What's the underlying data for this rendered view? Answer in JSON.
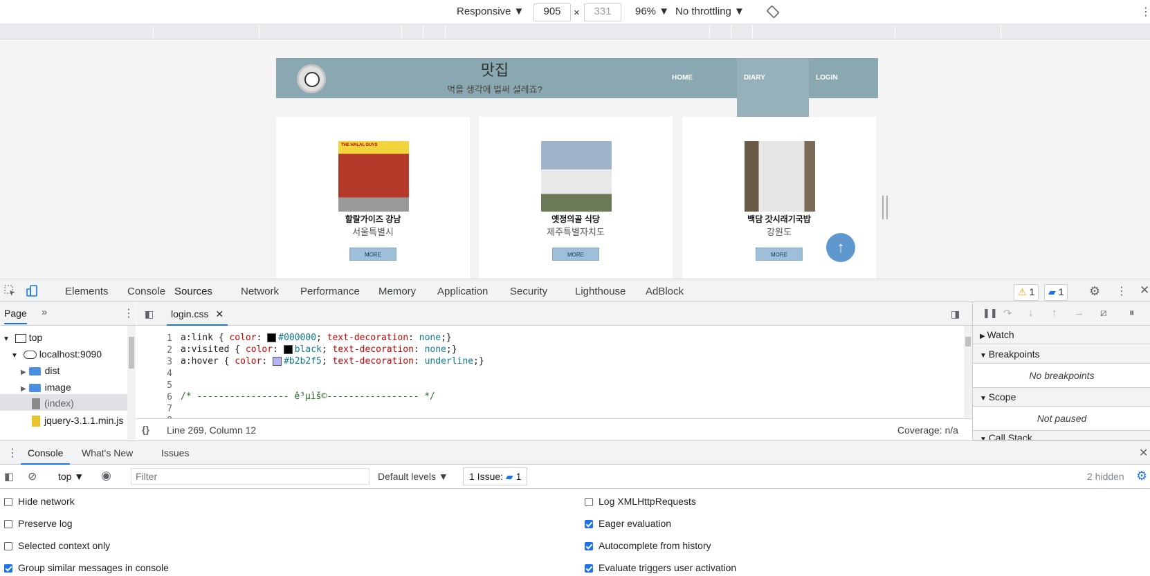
{
  "device_toolbar": {
    "mode": "Responsive ▼",
    "width": "905",
    "times": "×",
    "height": "331",
    "zoom": "96% ▼",
    "throttling": "No throttling ▼"
  },
  "site": {
    "title": "맛집",
    "subtitle": "먹을 생각에 벌써 설레죠?",
    "nav": [
      "HOME",
      "DIARY",
      "LOGIN"
    ],
    "cards": [
      {
        "name": "할랄가이즈 강남",
        "location": "서울특별시",
        "more": "MORE",
        "img_color": "#b53a2a",
        "sign": "THE HALAL GUYS"
      },
      {
        "name": "옛정의골 식당",
        "location": "제주특별자치도",
        "more": "MORE",
        "img_color": "#8fa3b8",
        "sign": ""
      },
      {
        "name": "백담 갓시래기국밥",
        "location": "강원도",
        "more": "MORE",
        "img_color": "#6b5a48",
        "sign": ""
      }
    ],
    "to_top": "↑"
  },
  "devtools": {
    "tabs": [
      "Elements",
      "Console",
      "Sources",
      "Network",
      "Performance",
      "Memory",
      "Application",
      "Security",
      "Lighthouse",
      "AdBlock"
    ],
    "active_tab": "Sources",
    "warnings": "1",
    "messages": "1",
    "nav_tab": "Page",
    "tree": {
      "top": "top",
      "host": "localhost:9090",
      "dist": "dist",
      "image": "image",
      "index": "(index)",
      "jquery": "jquery-3.1.1.min.js"
    },
    "file_tab": "login.css",
    "code": {
      "l1": {
        "sel": "a:link { ",
        "p1": "color",
        "v1": "#000000",
        "p2": "text-decoration",
        "v2": "none",
        "sw": "#000000"
      },
      "l2": {
        "sel": "a:visited { ",
        "p1": "color",
        "v1": "black",
        "p2": "text-decoration",
        "v2": "none",
        "sw": "#000000"
      },
      "l3": {
        "sel": "a:hover { ",
        "p1": "color",
        "v1": "#b2b2f5",
        "p2": "text-decoration",
        "v2": "underline",
        "sw": "#b2b2f5"
      },
      "l6": "/* ----------------- ê³µìš©----------------- */"
    },
    "status": "Line 269, Column 12",
    "coverage": "Coverage: n/a",
    "debugger": {
      "watch": "Watch",
      "breakpoints": "Breakpoints",
      "no_breakpoints": "No breakpoints",
      "scope": "Scope",
      "not_paused": "Not paused",
      "call_stack": "Call Stack"
    }
  },
  "drawer": {
    "tabs": [
      "Console",
      "What's New",
      "Issues"
    ],
    "context": "top ▼",
    "filter_placeholder": "Filter",
    "levels": "Default levels ▼",
    "issues": "1 Issue:",
    "issues_count": "1",
    "hidden": "2 hidden",
    "options_left": [
      {
        "label": "Hide network",
        "checked": false
      },
      {
        "label": "Preserve log",
        "checked": false
      },
      {
        "label": "Selected context only",
        "checked": false
      },
      {
        "label": "Group similar messages in console",
        "checked": true
      }
    ],
    "options_right": [
      {
        "label": "Log XMLHttpRequests",
        "checked": false
      },
      {
        "label": "Eager evaluation",
        "checked": true
      },
      {
        "label": "Autocomplete from history",
        "checked": true
      },
      {
        "label": "Evaluate triggers user activation",
        "checked": true
      }
    ]
  }
}
